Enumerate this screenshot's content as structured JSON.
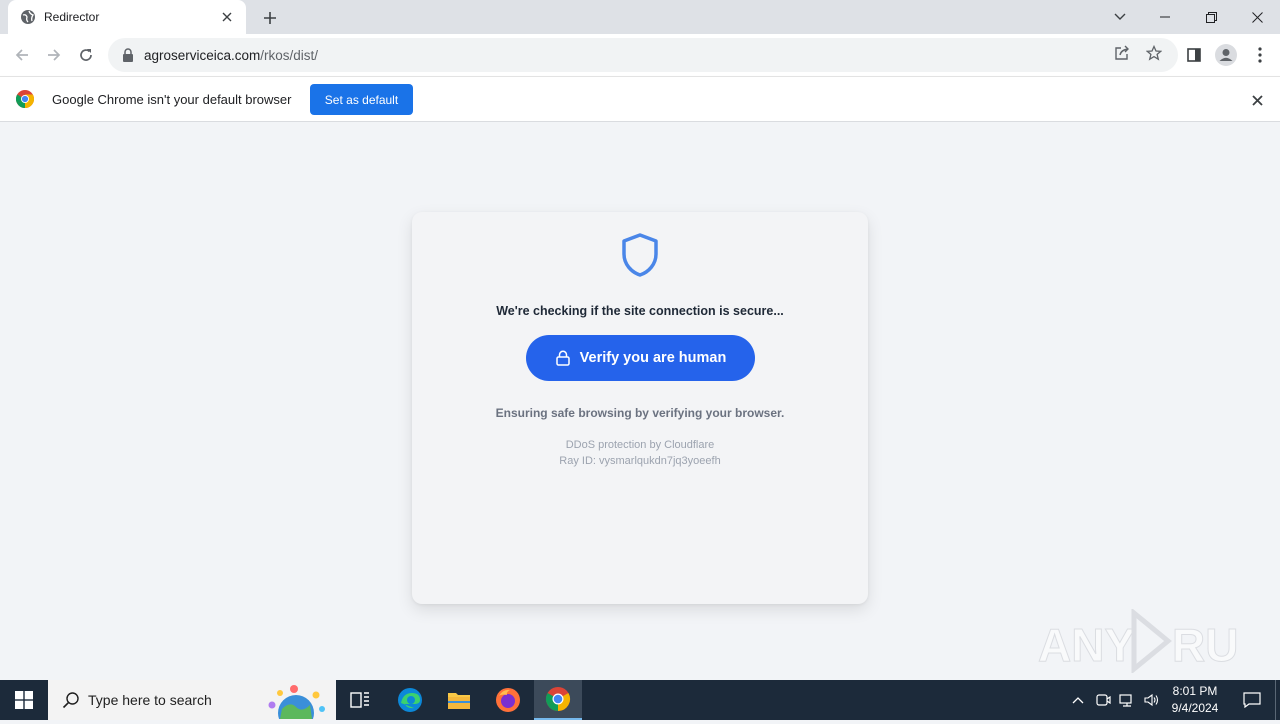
{
  "browser": {
    "tab_title": "Redirector",
    "url_domain": "agroserviceica.com",
    "url_path": "/rkos/dist/"
  },
  "infobar": {
    "message": "Google Chrome isn't your default browser",
    "button_label": "Set as default"
  },
  "card": {
    "heading": "We're checking if the site connection is secure...",
    "button_label": "Verify you are human",
    "subtext": "Ensuring safe browsing by verifying your browser.",
    "ddos": "DDoS protection by Cloudflare",
    "ray_id": "Ray ID: vysmarlqukdn7jq3yoeefh"
  },
  "watermark": {
    "text": "ANY RUN"
  },
  "taskbar": {
    "search_placeholder": "Type here to search",
    "time": "8:01 PM",
    "date": "9/4/2024"
  },
  "colors": {
    "accent_blue": "#2563eb",
    "chrome_blue": "#1a73e8",
    "taskbar": "#1c2a3a"
  }
}
